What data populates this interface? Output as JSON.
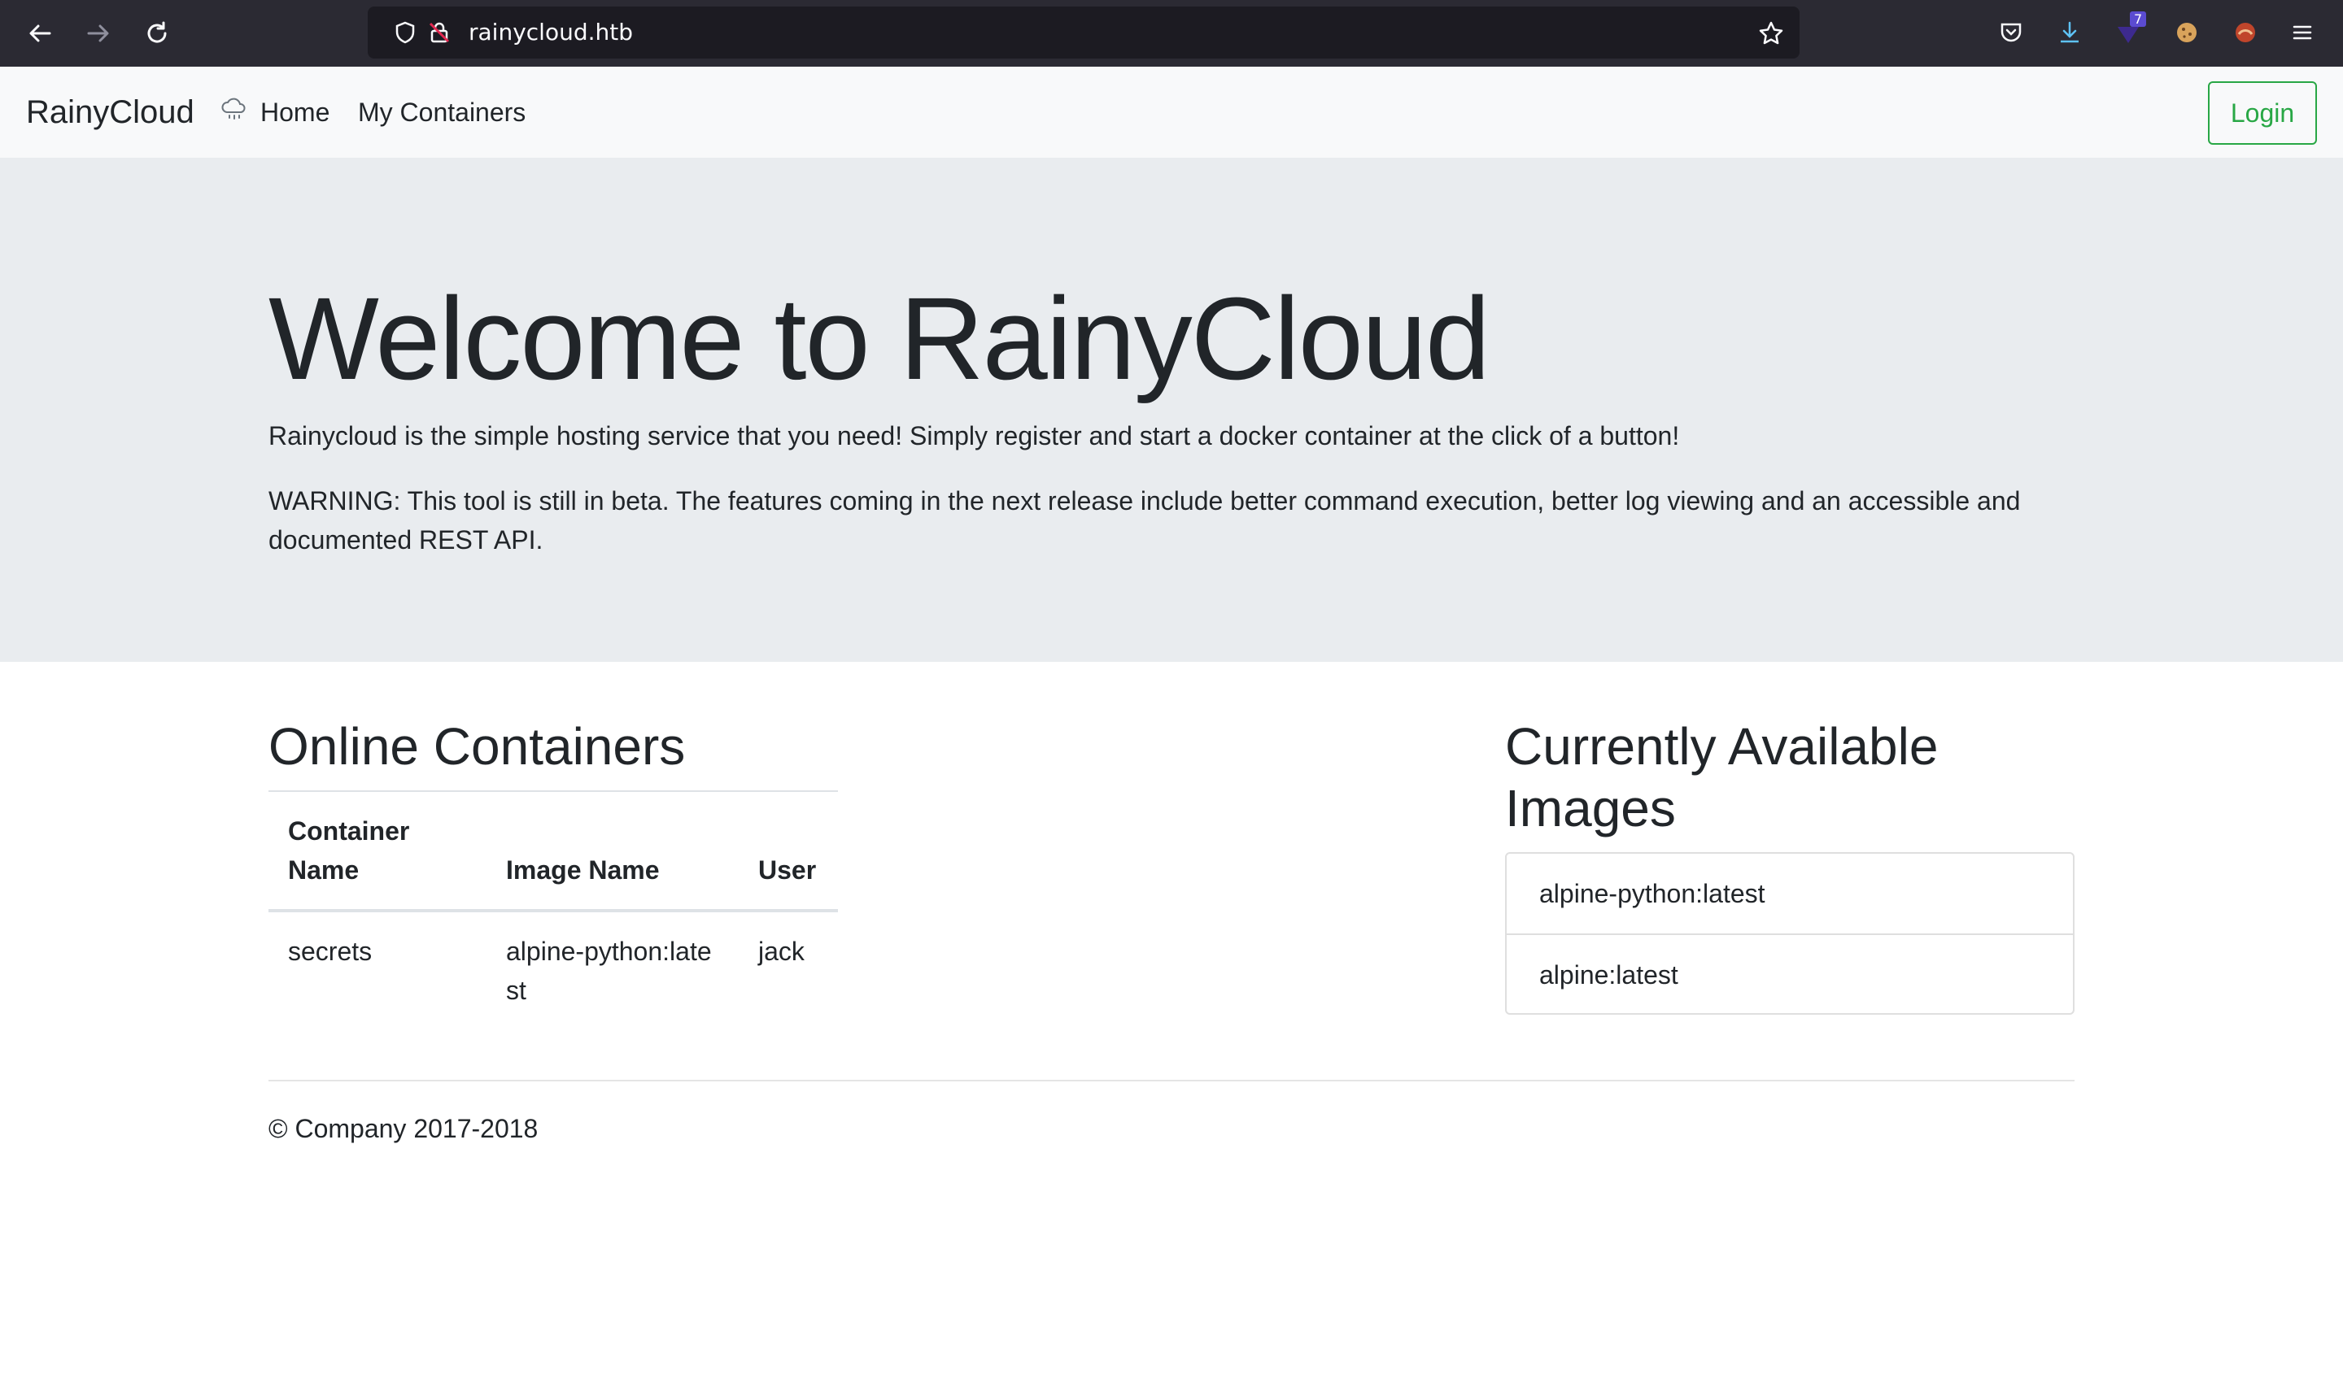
{
  "browser": {
    "url": "rainycloud.htb",
    "extension_badge": "7"
  },
  "navbar": {
    "brand": "RainyCloud",
    "home_label": "Home",
    "containers_label": "My Containers",
    "login_label": "Login"
  },
  "jumbotron": {
    "title": "Welcome to RainyCloud",
    "lead": "Rainycloud is the simple hosting service that you need! Simply register and start a docker container at the click of a button!",
    "warning": "WARNING: This tool is still in beta. The features coming in the next release include better command execution, better log viewing and an accessible and documented REST API."
  },
  "online_containers": {
    "title": "Online Containers",
    "columns": [
      "Container Name",
      "Image Name",
      "User"
    ],
    "rows": [
      {
        "container": "secrets",
        "image": "alpine-python:latest",
        "user": "jack"
      }
    ]
  },
  "available_images": {
    "title": "Currently Available Images",
    "items": [
      "alpine-python:latest",
      "alpine:latest"
    ]
  },
  "footer": {
    "text": "© Company 2017-2018"
  },
  "colors": {
    "accent_green": "#28a745",
    "jumbotron_bg": "#e9ecef",
    "navbar_bg": "#f8f9fa",
    "chrome_bg": "#2b2a33"
  }
}
